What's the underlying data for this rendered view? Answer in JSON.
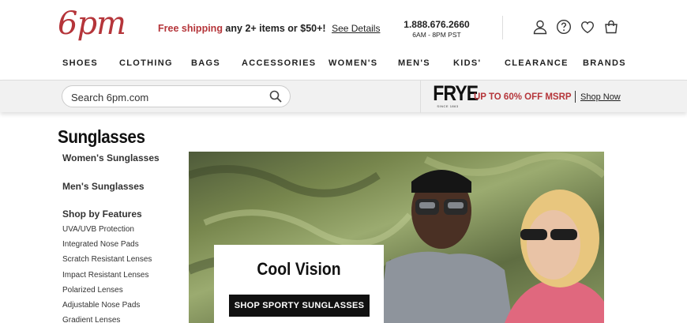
{
  "header": {
    "logo": "6pm",
    "promo": {
      "highlight": "Free shipping",
      "text": " any 2+ items or $50+!",
      "details_link": "See Details"
    },
    "phone": {
      "number": "1.888.676.2660",
      "hours": "6AM - 8PM PST"
    },
    "icons": [
      "account-icon",
      "help-icon",
      "favorites-icon",
      "cart-icon"
    ]
  },
  "nav": {
    "items": [
      "SHOES",
      "CLOTHING",
      "BAGS",
      "ACCESSORIES",
      "WOMEN'S",
      "MEN'S",
      "KIDS'",
      "CLEARANCE",
      "BRANDS"
    ]
  },
  "search": {
    "placeholder": "Search 6pm.com"
  },
  "banner": {
    "brand": "FRYE",
    "brand_sub": "SINCE 1863",
    "offer": "UP TO 60% OFF MSRP",
    "link": "Shop Now"
  },
  "sidebar": {
    "title": "Sunglasses",
    "sections": [
      "Women's Sunglasses",
      "Men's Sunglasses",
      "Shop by Features"
    ],
    "features": [
      "UVA/UVB Protection",
      "Integrated Nose Pads",
      "Scratch Resistant Lenses",
      "Impact Resistant Lenses",
      "Polarized Lenses",
      "Adjustable Nose Pads",
      "Gradient Lenses"
    ]
  },
  "hero": {
    "title": "Cool Vision",
    "cta": "SHOP SPORTY SUNGLASSES"
  },
  "colors": {
    "brand_red": "#b5353a",
    "text": "#222222",
    "band_bg": "#f1f1f1"
  }
}
